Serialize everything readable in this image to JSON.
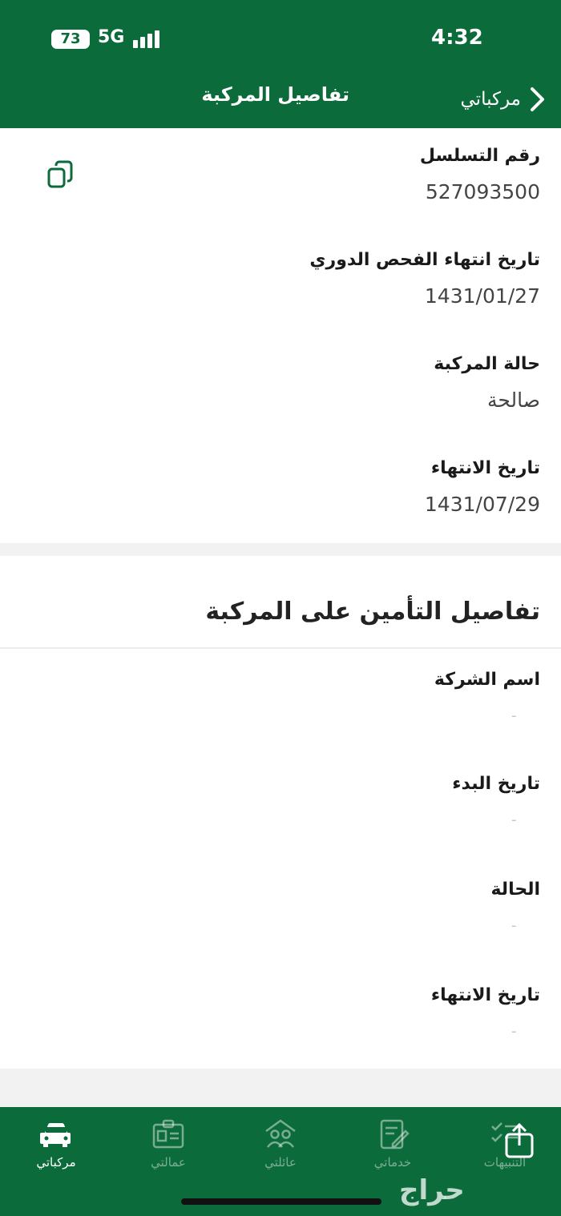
{
  "status_bar": {
    "battery": "73",
    "network": "5G",
    "time": "4:32"
  },
  "nav": {
    "title": "تفاصيل المركبة",
    "back_label": "مركباتي"
  },
  "vehicle": {
    "fields": [
      {
        "label": "رقم التسلسل",
        "value": "527093500"
      },
      {
        "label": "تاريخ انتهاء الفحص الدوري",
        "value": "1431/01/27"
      },
      {
        "label": "حالة المركبة",
        "value": "صالحة"
      },
      {
        "label": "تاريخ الانتهاء",
        "value": "1431/07/29"
      }
    ]
  },
  "insurance": {
    "title": "تفاصيل التأمين على المركبة",
    "fields": [
      {
        "label": "اسم الشركة",
        "value": "-"
      },
      {
        "label": "تاريخ البدء",
        "value": "-"
      },
      {
        "label": "الحالة",
        "value": "-"
      },
      {
        "label": "تاريخ الانتهاء",
        "value": "-"
      }
    ]
  },
  "tabs": [
    {
      "label": "مركباتي",
      "icon": "car-icon",
      "active": true
    },
    {
      "label": "عمالتي",
      "icon": "id-card-icon",
      "active": false
    },
    {
      "label": "عائلتي",
      "icon": "family-icon",
      "active": false
    },
    {
      "label": "خدماتي",
      "icon": "services-icon",
      "active": false
    },
    {
      "label": "التنبيهات",
      "icon": "notifications-icon",
      "active": false
    }
  ],
  "watermark": "حراج",
  "colors": {
    "brand": "#0b6b3a",
    "background": "#f2f2f2"
  }
}
